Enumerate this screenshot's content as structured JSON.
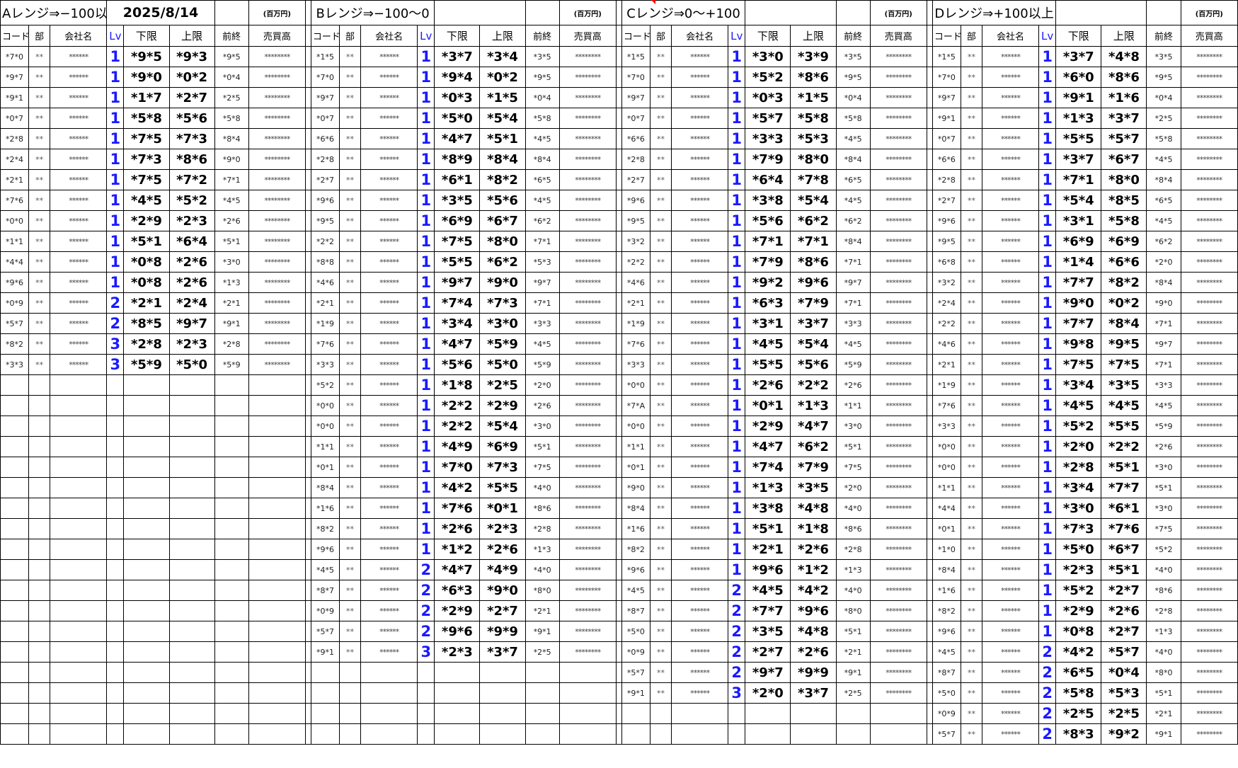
{
  "date": "2025/8/14",
  "unit_label": "(百万円)",
  "header_labels": [
    "コード",
    "部",
    "会社名",
    "Lv",
    "下限",
    "上限",
    "前終",
    "売買高"
  ],
  "sections": [
    {
      "title": "Aレンジ⇒−100以",
      "rows": [
        [
          "*7*0",
          "**",
          "******",
          "1",
          "*9*5",
          "*9*3",
          "*9*5",
          "********"
        ],
        [
          "*9*7",
          "**",
          "******",
          "1",
          "*9*0",
          "*0*2",
          "*0*4",
          "********"
        ],
        [
          "*9*1",
          "**",
          "******",
          "1",
          "*1*7",
          "*2*7",
          "*2*5",
          "********"
        ],
        [
          "*0*7",
          "**",
          "******",
          "1",
          "*5*8",
          "*5*6",
          "*5*8",
          "********"
        ],
        [
          "*2*8",
          "**",
          "******",
          "1",
          "*7*5",
          "*7*3",
          "*8*4",
          "********"
        ],
        [
          "*2*4",
          "**",
          "******",
          "1",
          "*7*3",
          "*8*6",
          "*9*0",
          "********"
        ],
        [
          "*2*1",
          "**",
          "******",
          "1",
          "*7*5",
          "*7*2",
          "*7*1",
          "********"
        ],
        [
          "*7*6",
          "**",
          "******",
          "1",
          "*4*5",
          "*5*2",
          "*4*5",
          "********"
        ],
        [
          "*0*0",
          "**",
          "******",
          "1",
          "*2*9",
          "*2*3",
          "*2*6",
          "********"
        ],
        [
          "*1*1",
          "**",
          "******",
          "1",
          "*5*1",
          "*6*4",
          "*5*1",
          "********"
        ],
        [
          "*4*4",
          "**",
          "******",
          "1",
          "*0*8",
          "*2*6",
          "*3*0",
          "********"
        ],
        [
          "*9*6",
          "**",
          "******",
          "1",
          "*0*8",
          "*2*6",
          "*1*3",
          "********"
        ],
        [
          "*0*9",
          "**",
          "******",
          "2",
          "*2*1",
          "*2*4",
          "*2*1",
          "********"
        ],
        [
          "*5*7",
          "**",
          "******",
          "2",
          "*8*5",
          "*9*7",
          "*9*1",
          "********"
        ],
        [
          "*8*2",
          "**",
          "******",
          "3",
          "*2*8",
          "*2*3",
          "*2*8",
          "********"
        ],
        [
          "*3*3",
          "**",
          "******",
          "3",
          "*5*9",
          "*5*0",
          "*5*9",
          "********"
        ]
      ]
    },
    {
      "title": "Bレンジ⇒−100〜0",
      "rows": [
        [
          "*1*5",
          "**",
          "******",
          "1",
          "*3*7",
          "*3*4",
          "*3*5",
          "********"
        ],
        [
          "*7*0",
          "**",
          "******",
          "1",
          "*9*4",
          "*0*2",
          "*9*5",
          "********"
        ],
        [
          "*9*7",
          "**",
          "******",
          "1",
          "*0*3",
          "*1*5",
          "*0*4",
          "********"
        ],
        [
          "*0*7",
          "**",
          "******",
          "1",
          "*5*0",
          "*5*4",
          "*5*8",
          "********"
        ],
        [
          "*6*6",
          "**",
          "******",
          "1",
          "*4*7",
          "*5*1",
          "*4*5",
          "********"
        ],
        [
          "*2*8",
          "**",
          "******",
          "1",
          "*8*9",
          "*8*4",
          "*8*4",
          "********"
        ],
        [
          "*2*7",
          "**",
          "******",
          "1",
          "*6*1",
          "*8*2",
          "*6*5",
          "********"
        ],
        [
          "*9*6",
          "**",
          "******",
          "1",
          "*3*5",
          "*5*6",
          "*4*5",
          "********"
        ],
        [
          "*9*5",
          "**",
          "******",
          "1",
          "*6*9",
          "*6*7",
          "*6*2",
          "********"
        ],
        [
          "*2*2",
          "**",
          "******",
          "1",
          "*7*5",
          "*8*0",
          "*7*1",
          "********"
        ],
        [
          "*8*8",
          "**",
          "******",
          "1",
          "*5*5",
          "*6*2",
          "*5*3",
          "********"
        ],
        [
          "*4*6",
          "**",
          "******",
          "1",
          "*9*7",
          "*9*0",
          "*9*7",
          "********"
        ],
        [
          "*2*1",
          "**",
          "******",
          "1",
          "*7*4",
          "*7*3",
          "*7*1",
          "********"
        ],
        [
          "*1*9",
          "**",
          "******",
          "1",
          "*3*4",
          "*3*0",
          "*3*3",
          "********"
        ],
        [
          "*7*6",
          "**",
          "******",
          "1",
          "*4*7",
          "*5*9",
          "*4*5",
          "********"
        ],
        [
          "*3*3",
          "**",
          "******",
          "1",
          "*5*6",
          "*5*0",
          "*5*9",
          "********"
        ],
        [
          "*5*2",
          "**",
          "******",
          "1",
          "*1*8",
          "*2*5",
          "*2*0",
          "********"
        ],
        [
          "*0*0",
          "**",
          "******",
          "1",
          "*2*2",
          "*2*9",
          "*2*6",
          "********"
        ],
        [
          "*0*0",
          "**",
          "******",
          "1",
          "*2*2",
          "*5*4",
          "*3*0",
          "********"
        ],
        [
          "*1*1",
          "**",
          "******",
          "1",
          "*4*9",
          "*6*9",
          "*5*1",
          "********"
        ],
        [
          "*0*1",
          "**",
          "******",
          "1",
          "*7*0",
          "*7*3",
          "*7*5",
          "********"
        ],
        [
          "*8*4",
          "**",
          "******",
          "1",
          "*4*2",
          "*5*5",
          "*4*0",
          "********"
        ],
        [
          "*1*6",
          "**",
          "******",
          "1",
          "*7*6",
          "*0*1",
          "*8*6",
          "********"
        ],
        [
          "*8*2",
          "**",
          "******",
          "1",
          "*2*6",
          "*2*3",
          "*2*8",
          "********"
        ],
        [
          "*9*6",
          "**",
          "******",
          "1",
          "*1*2",
          "*2*6",
          "*1*3",
          "********"
        ],
        [
          "*4*5",
          "**",
          "******",
          "2",
          "*4*7",
          "*4*9",
          "*4*0",
          "********"
        ],
        [
          "*8*7",
          "**",
          "******",
          "2",
          "*6*3",
          "*9*0",
          "*8*0",
          "********"
        ],
        [
          "*0*9",
          "**",
          "******",
          "2",
          "*2*9",
          "*2*7",
          "*2*1",
          "********"
        ],
        [
          "*5*7",
          "**",
          "******",
          "2",
          "*9*6",
          "*9*9",
          "*9*1",
          "********"
        ],
        [
          "*9*1",
          "**",
          "******",
          "3",
          "*2*3",
          "*3*7",
          "*2*5",
          "********"
        ]
      ]
    },
    {
      "title": "Cレンジ⇒0〜+100",
      "rows": [
        [
          "*1*5",
          "**",
          "******",
          "1",
          "*3*0",
          "*3*9",
          "*3*5",
          "********"
        ],
        [
          "*7*0",
          "**",
          "******",
          "1",
          "*5*2",
          "*8*6",
          "*9*5",
          "********"
        ],
        [
          "*9*7",
          "**",
          "******",
          "1",
          "*0*3",
          "*1*5",
          "*0*4",
          "********"
        ],
        [
          "*0*7",
          "**",
          "******",
          "1",
          "*5*7",
          "*5*8",
          "*5*8",
          "********"
        ],
        [
          "*6*6",
          "**",
          "******",
          "1",
          "*3*3",
          "*5*3",
          "*4*5",
          "********"
        ],
        [
          "*2*8",
          "**",
          "******",
          "1",
          "*7*9",
          "*8*0",
          "*8*4",
          "********"
        ],
        [
          "*2*7",
          "**",
          "******",
          "1",
          "*6*4",
          "*7*8",
          "*6*5",
          "********"
        ],
        [
          "*9*6",
          "**",
          "******",
          "1",
          "*3*8",
          "*5*4",
          "*4*5",
          "********"
        ],
        [
          "*9*5",
          "**",
          "******",
          "1",
          "*5*6",
          "*6*2",
          "*6*2",
          "********"
        ],
        [
          "*3*2",
          "**",
          "******",
          "1",
          "*7*1",
          "*7*1",
          "*8*4",
          "********"
        ],
        [
          "*2*2",
          "**",
          "******",
          "1",
          "*7*9",
          "*8*6",
          "*7*1",
          "********"
        ],
        [
          "*4*6",
          "**",
          "******",
          "1",
          "*9*2",
          "*9*6",
          "*9*7",
          "********"
        ],
        [
          "*2*1",
          "**",
          "******",
          "1",
          "*6*3",
          "*7*9",
          "*7*1",
          "********"
        ],
        [
          "*1*9",
          "**",
          "******",
          "1",
          "*3*1",
          "*3*7",
          "*3*3",
          "********"
        ],
        [
          "*7*6",
          "**",
          "******",
          "1",
          "*4*5",
          "*5*4",
          "*4*5",
          "********"
        ],
        [
          "*3*3",
          "**",
          "******",
          "1",
          "*5*5",
          "*5*6",
          "*5*9",
          "********"
        ],
        [
          "*0*0",
          "**",
          "******",
          "1",
          "*2*6",
          "*2*2",
          "*2*6",
          "********"
        ],
        [
          "*7*A",
          "**",
          "******",
          "1",
          "*0*1",
          "*1*3",
          "*1*1",
          "********"
        ],
        [
          "*0*0",
          "**",
          "******",
          "1",
          "*2*9",
          "*4*7",
          "*3*0",
          "********"
        ],
        [
          "*1*1",
          "**",
          "******",
          "1",
          "*4*7",
          "*6*2",
          "*5*1",
          "********"
        ],
        [
          "*0*1",
          "**",
          "******",
          "1",
          "*7*4",
          "*7*9",
          "*7*5",
          "********"
        ],
        [
          "*9*0",
          "**",
          "******",
          "1",
          "*1*3",
          "*3*5",
          "*2*0",
          "********"
        ],
        [
          "*8*4",
          "**",
          "******",
          "1",
          "*3*8",
          "*4*8",
          "*4*0",
          "********"
        ],
        [
          "*1*6",
          "**",
          "******",
          "1",
          "*5*1",
          "*1*8",
          "*8*6",
          "********"
        ],
        [
          "*8*2",
          "**",
          "******",
          "1",
          "*2*1",
          "*2*6",
          "*2*8",
          "********"
        ],
        [
          "*9*6",
          "**",
          "******",
          "1",
          "*9*6",
          "*1*2",
          "*1*3",
          "********"
        ],
        [
          "*4*5",
          "**",
          "******",
          "2",
          "*4*5",
          "*4*2",
          "*4*0",
          "********"
        ],
        [
          "*8*7",
          "**",
          "******",
          "2",
          "*7*7",
          "*9*6",
          "*8*0",
          "********"
        ],
        [
          "*5*0",
          "**",
          "******",
          "2",
          "*3*5",
          "*4*8",
          "*5*1",
          "********"
        ],
        [
          "*0*9",
          "**",
          "******",
          "2",
          "*2*7",
          "*2*6",
          "*2*1",
          "********"
        ],
        [
          "*5*7",
          "**",
          "******",
          "2",
          "*9*7",
          "*9*9",
          "*9*1",
          "********"
        ],
        [
          "*9*1",
          "**",
          "******",
          "3",
          "*2*0",
          "*3*7",
          "*2*5",
          "********"
        ]
      ]
    },
    {
      "title": "Dレンジ⇒+100以上",
      "rows": [
        [
          "*1*5",
          "**",
          "******",
          "1",
          "*3*7",
          "*4*8",
          "*3*5",
          "********"
        ],
        [
          "*7*0",
          "**",
          "******",
          "1",
          "*6*0",
          "*8*6",
          "*9*5",
          "********"
        ],
        [
          "*9*7",
          "**",
          "******",
          "1",
          "*9*1",
          "*1*6",
          "*0*4",
          "********"
        ],
        [
          "*9*1",
          "**",
          "******",
          "1",
          "*1*3",
          "*3*7",
          "*2*5",
          "********"
        ],
        [
          "*0*7",
          "**",
          "******",
          "1",
          "*5*5",
          "*5*7",
          "*5*8",
          "********"
        ],
        [
          "*6*6",
          "**",
          "******",
          "1",
          "*3*7",
          "*6*7",
          "*4*5",
          "********"
        ],
        [
          "*2*8",
          "**",
          "******",
          "1",
          "*7*1",
          "*8*0",
          "*8*4",
          "********"
        ],
        [
          "*2*7",
          "**",
          "******",
          "1",
          "*5*4",
          "*8*5",
          "*6*5",
          "********"
        ],
        [
          "*9*6",
          "**",
          "******",
          "1",
          "*3*1",
          "*5*8",
          "*4*5",
          "********"
        ],
        [
          "*9*5",
          "**",
          "******",
          "1",
          "*6*9",
          "*6*9",
          "*6*2",
          "********"
        ],
        [
          "*6*8",
          "**",
          "******",
          "1",
          "*1*4",
          "*6*6",
          "*2*0",
          "********"
        ],
        [
          "*3*2",
          "**",
          "******",
          "1",
          "*7*7",
          "*8*2",
          "*8*4",
          "********"
        ],
        [
          "*2*4",
          "**",
          "******",
          "1",
          "*9*0",
          "*0*2",
          "*9*0",
          "********"
        ],
        [
          "*2*2",
          "**",
          "******",
          "1",
          "*7*7",
          "*8*4",
          "*7*1",
          "********"
        ],
        [
          "*4*6",
          "**",
          "******",
          "1",
          "*9*8",
          "*9*5",
          "*9*7",
          "********"
        ],
        [
          "*2*1",
          "**",
          "******",
          "1",
          "*7*5",
          "*7*5",
          "*7*1",
          "********"
        ],
        [
          "*1*9",
          "**",
          "******",
          "1",
          "*3*4",
          "*3*5",
          "*3*3",
          "********"
        ],
        [
          "*7*6",
          "**",
          "******",
          "1",
          "*4*5",
          "*4*5",
          "*4*5",
          "********"
        ],
        [
          "*3*3",
          "**",
          "******",
          "1",
          "*5*2",
          "*5*5",
          "*5*9",
          "********"
        ],
        [
          "*0*0",
          "**",
          "******",
          "1",
          "*2*0",
          "*2*2",
          "*2*6",
          "********"
        ],
        [
          "*0*0",
          "**",
          "******",
          "1",
          "*2*8",
          "*5*1",
          "*3*0",
          "********"
        ],
        [
          "*1*1",
          "**",
          "******",
          "1",
          "*3*4",
          "*7*7",
          "*5*1",
          "********"
        ],
        [
          "*4*4",
          "**",
          "******",
          "1",
          "*3*0",
          "*6*1",
          "*3*0",
          "********"
        ],
        [
          "*0*1",
          "**",
          "******",
          "1",
          "*7*3",
          "*7*6",
          "*7*5",
          "********"
        ],
        [
          "*1*0",
          "**",
          "******",
          "1",
          "*5*0",
          "*6*7",
          "*5*2",
          "********"
        ],
        [
          "*8*4",
          "**",
          "******",
          "1",
          "*2*3",
          "*5*1",
          "*4*0",
          "********"
        ],
        [
          "*1*6",
          "**",
          "******",
          "1",
          "*5*2",
          "*2*7",
          "*8*6",
          "********"
        ],
        [
          "*8*2",
          "**",
          "******",
          "1",
          "*2*9",
          "*2*6",
          "*2*8",
          "********"
        ],
        [
          "*9*6",
          "**",
          "******",
          "1",
          "*0*8",
          "*2*7",
          "*1*3",
          "********"
        ],
        [
          "*4*5",
          "**",
          "******",
          "2",
          "*4*2",
          "*5*7",
          "*4*0",
          "********"
        ],
        [
          "*8*7",
          "**",
          "******",
          "2",
          "*6*5",
          "*0*4",
          "*8*0",
          "********"
        ],
        [
          "*5*0",
          "**",
          "******",
          "2",
          "*5*8",
          "*5*3",
          "*5*1",
          "********"
        ],
        [
          "*0*9",
          "**",
          "******",
          "2",
          "*2*5",
          "*2*5",
          "*2*1",
          "********"
        ],
        [
          "*5*7",
          "**",
          "******",
          "2",
          "*8*3",
          "*9*2",
          "*9*1",
          "********"
        ]
      ]
    }
  ]
}
